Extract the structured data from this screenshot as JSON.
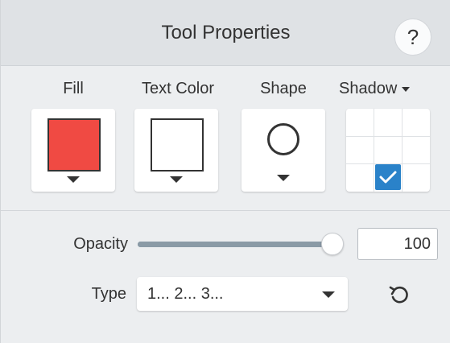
{
  "panel": {
    "title": "Tool Properties",
    "help_label": "?"
  },
  "properties": {
    "fill": {
      "label": "Fill",
      "color": "#f04a43"
    },
    "text_color": {
      "label": "Text Color",
      "color": "#ffffff"
    },
    "shape": {
      "label": "Shape",
      "icon": "circle-icon"
    },
    "shadow": {
      "label": "Shadow",
      "selected_position": "bottom-center",
      "accent": "#2a82c9"
    }
  },
  "opacity": {
    "label": "Opacity",
    "value": "100",
    "fraction": 1.0
  },
  "type": {
    "label": "Type",
    "value": "1... 2... 3..."
  },
  "reset": {
    "icon": "reset-icon"
  }
}
